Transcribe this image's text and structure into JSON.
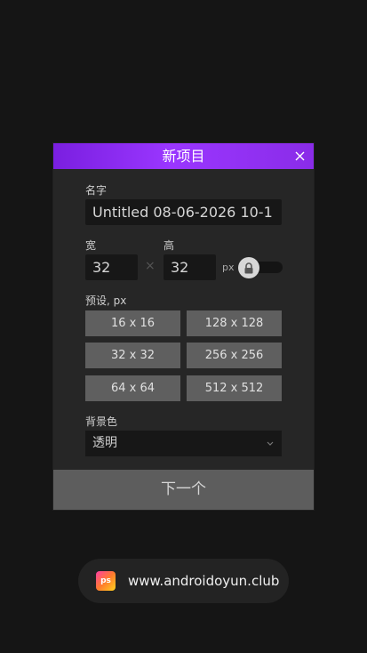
{
  "dialog": {
    "title": "新项目",
    "name_label": "名字",
    "name_value": "Untitled 08-06-2026 10-1",
    "width_label": "宽",
    "height_label": "高",
    "width_value": "32",
    "height_value": "32",
    "times_symbol": "×",
    "unit": "px",
    "aspect_lock": true,
    "presets_label": "预设, px",
    "presets": [
      "16 x 16",
      "128 x 128",
      "32 x 32",
      "256 x 256",
      "64 x 64",
      "512 x 512"
    ],
    "background_label": "背景色",
    "background_value": "透明",
    "next_label": "下一个"
  },
  "footer": {
    "logo_text": "ps",
    "site": "www.androidoyun.club"
  },
  "colors": {
    "header_gradient_start": "#7a1fe0",
    "header_gradient_end": "#9a36ff",
    "dialog_bg": "#262626",
    "page_bg": "#151515"
  },
  "icons": {
    "close": "close-icon",
    "lock": "lock-icon",
    "dropdown": "chevron-down-icon",
    "logo": "app-logo-icon"
  }
}
